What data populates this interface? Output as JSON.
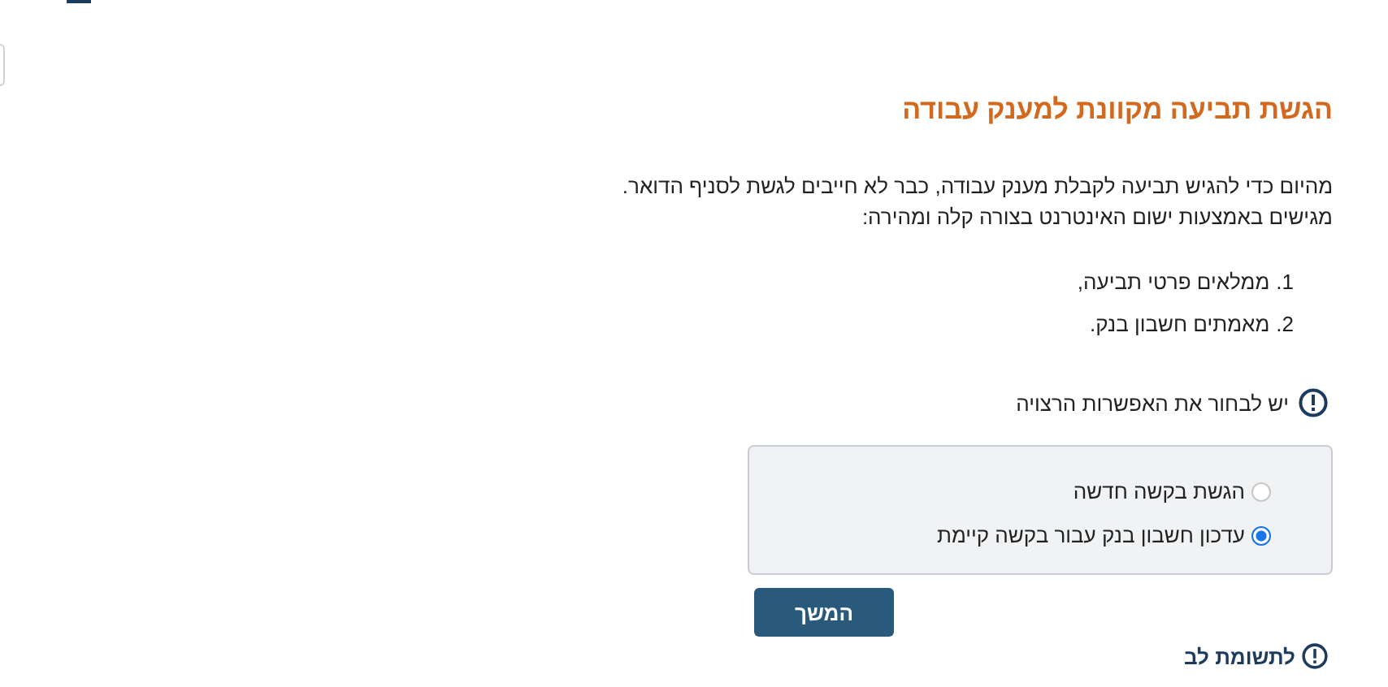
{
  "title": "הגשת תביעה מקוונת למענק עבודה",
  "intro": [
    "מהיום כדי להגיש תביעה לקבלת מענק עבודה, כבר לא חייבים לגשת לסניף הדואר.",
    "מגישים באמצעות ישום האינטרנט בצורה קלה ומהירה:"
  ],
  "steps": [
    {
      "number": "1.",
      "text": "ממלאים פרטי תביעה,"
    },
    {
      "number": "2.",
      "text": "מאמתים חשבון בנק."
    }
  ],
  "notice": "יש לבחור את האפשרות הרצויה",
  "options": [
    {
      "label": "הגשת בקשה חדשה",
      "selected": false
    },
    {
      "label": "עדכון חשבון בנק עבור בקשה קיימת",
      "selected": true
    }
  ],
  "continue_button": "המשך",
  "attention": "לתשומת לב"
}
